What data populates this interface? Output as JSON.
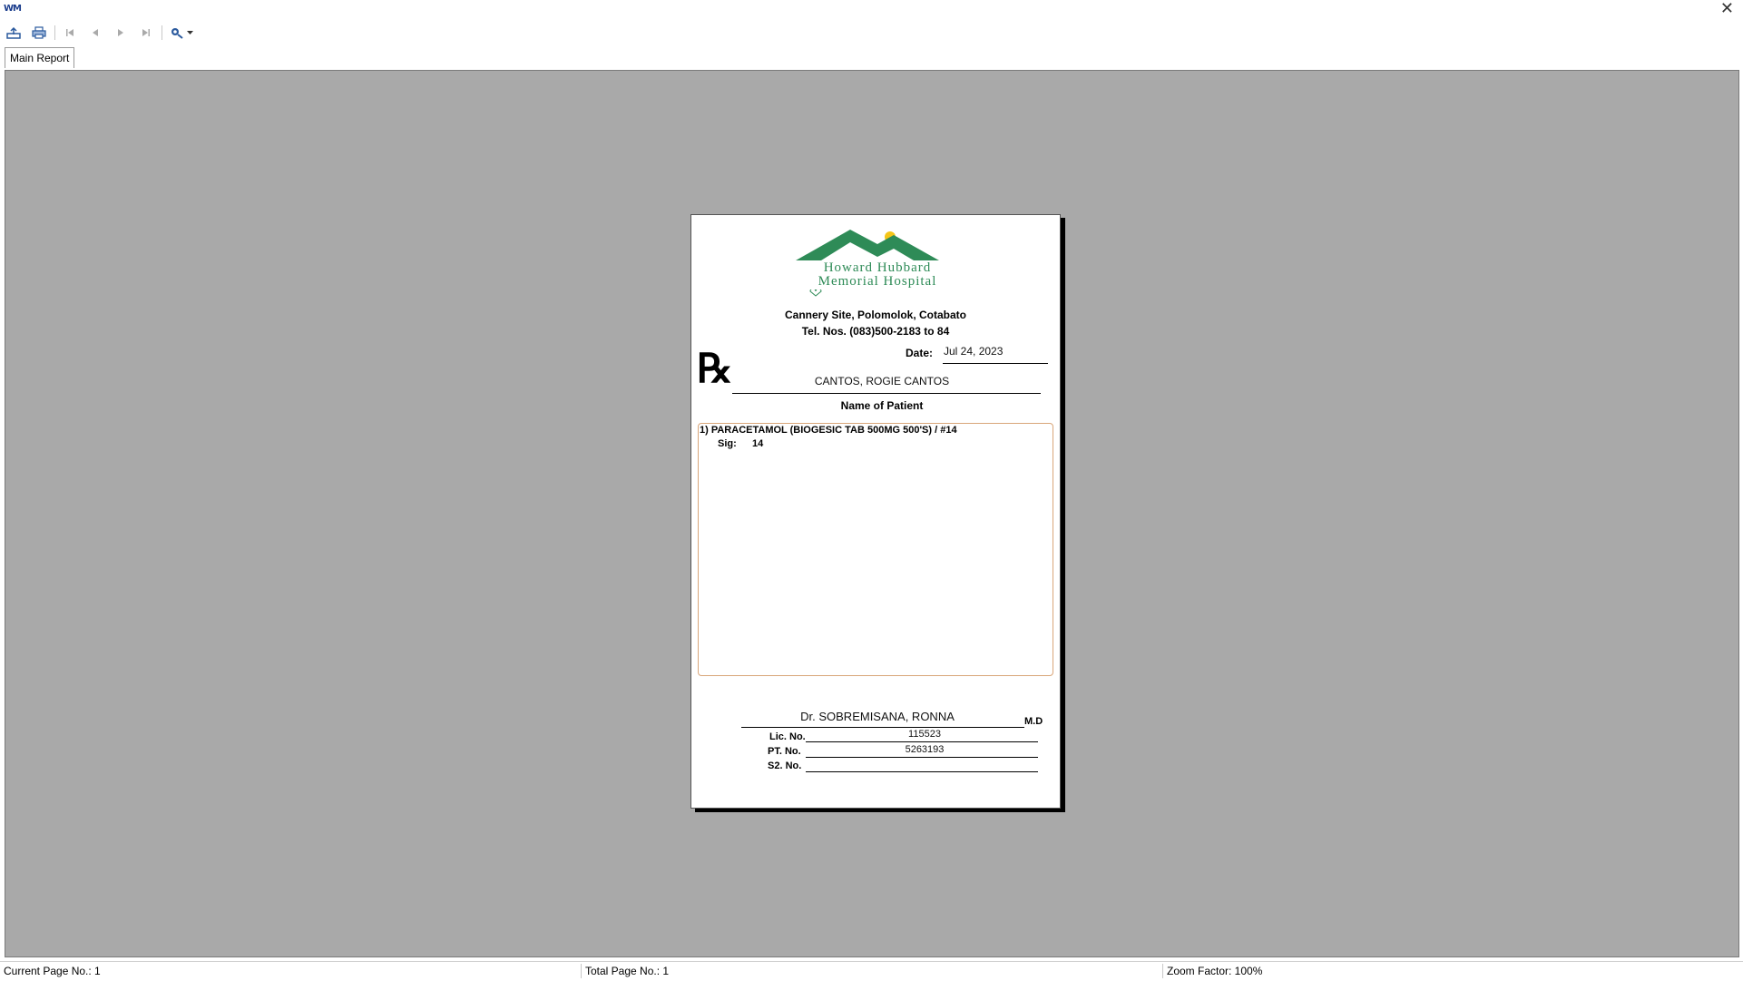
{
  "window": {
    "icon_text": "WM",
    "close_glyph": "✕"
  },
  "toolbar": {
    "buttons": [
      {
        "name": "export-icon",
        "glyph": "⇪"
      },
      {
        "name": "print-icon",
        "glyph": "⎙"
      },
      {
        "name": "first-page-icon",
        "glyph": "⏮"
      },
      {
        "name": "prev-page-icon",
        "glyph": "◀"
      },
      {
        "name": "next-page-icon",
        "glyph": "▶"
      },
      {
        "name": "last-page-icon",
        "glyph": "⏭"
      },
      {
        "name": "zoom-icon",
        "glyph": "⚙▾"
      }
    ]
  },
  "tabs": {
    "main": "Main Report"
  },
  "report": {
    "hospital_line1": "Howard Hubbard",
    "hospital_line2": "Memorial Hospital",
    "address": "Cannery Site, Polomolok, Cotabato",
    "phone": "Tel. Nos. (083)500-2183 to 84",
    "date_label": "Date:",
    "date_value": "Jul 24, 2023",
    "rx_symbol": "℞",
    "patient_name": "CANTOS, ROGIE CANTOS",
    "patient_label": "Name of Patient",
    "medication": "1) PARACETAMOL (BIOGESIC TAB 500MG 500'S)  / #14",
    "sig_label": "Sig:",
    "sig_value": "14",
    "doctor_name": "Dr. SOBREMISANA, RONNA",
    "doctor_suffix": "M.D",
    "lic_label": "Lic. No.",
    "lic_value": "115523",
    "ptr_label": "PT. No.",
    "ptr_value": "5263193",
    "s2_label": "S2. No.",
    "s2_value": ""
  },
  "status": {
    "current_page": "Current Page No.: 1",
    "total_page": "Total Page No.: 1",
    "zoom": "Zoom Factor: 100%"
  },
  "colors": {
    "viewer_bg": "#a9a9a9",
    "logo_green": "#2e8b57",
    "logo_sun": "#f5c518",
    "box_border": "#d9a679"
  }
}
